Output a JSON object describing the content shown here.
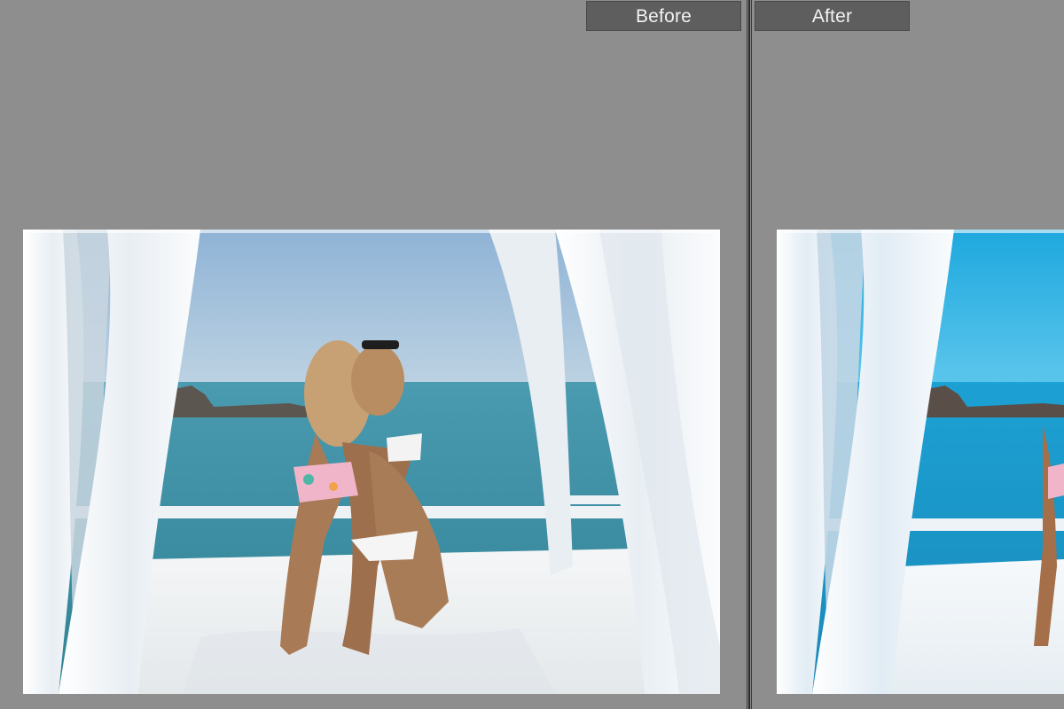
{
  "compare": {
    "before_label": "Before",
    "after_label": "After"
  },
  "colors": {
    "background": "#8e8e8e",
    "label_tab": "#5e5e5e",
    "label_text": "#f2f2f2",
    "before_sky": "#a8c4dc",
    "before_sea": "#3f8fa4",
    "after_sky": "#2bb3e4",
    "after_sea": "#1f9ccc"
  },
  "icons": {
    "photo_before": "beach-photo",
    "photo_after": "beach-photo"
  }
}
